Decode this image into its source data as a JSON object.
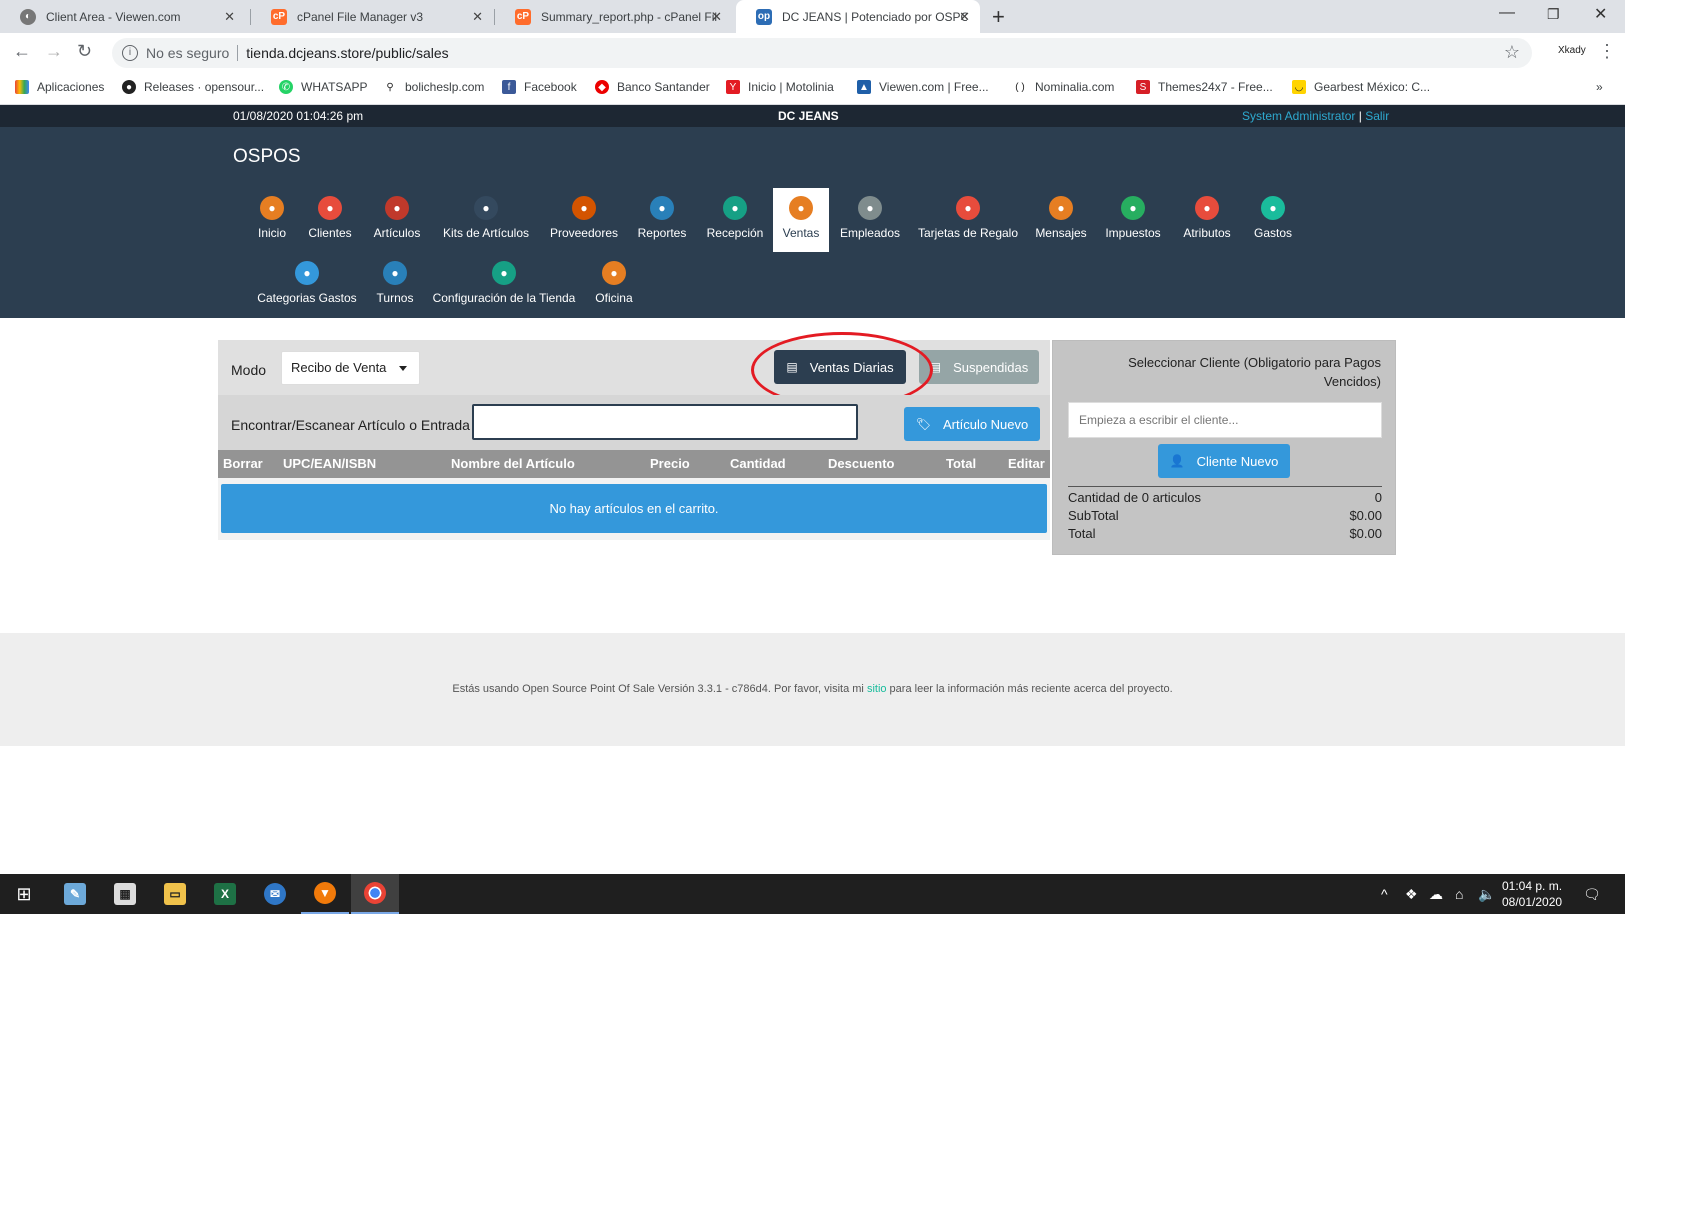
{
  "browser": {
    "tabs": [
      {
        "title": "Client Area - Viewen.com",
        "active": false
      },
      {
        "title": "cPanel File Manager v3",
        "active": false
      },
      {
        "title": "Summary_report.php - cPanel Fil",
        "active": false
      },
      {
        "title": "DC JEANS | Potenciado por OSPC",
        "active": true
      }
    ],
    "address": {
      "security_label": "No es seguro",
      "url": "tienda.dcjeans.store/public/sales"
    },
    "extension_label": "Xkady",
    "bookmarks": [
      "Aplicaciones",
      "Releases · opensour...",
      "WHATSAPP",
      "bolicheslp.com",
      "Facebook",
      "Banco Santander",
      "Inicio | Motolinia",
      "Viewen.com | Free...",
      "Nominalia.com",
      "Themes24x7 - Free...",
      "Gearbest México: C..."
    ],
    "more_bookmarks": "»"
  },
  "app": {
    "datetime": "01/08/2020 01:04:26 pm",
    "store_name": "DC JEANS",
    "user": "System Administrator",
    "user_sep": "|",
    "logout": "Salir",
    "brand": "OSPOS",
    "modules": [
      {
        "label": "Inicio",
        "color": "#e67e22"
      },
      {
        "label": "Clientes",
        "color": "#e74c3c"
      },
      {
        "label": "Artículos",
        "color": "#c0392b"
      },
      {
        "label": "Kits de Artículos",
        "color": "#34495e"
      },
      {
        "label": "Proveedores",
        "color": "#d35400"
      },
      {
        "label": "Reportes",
        "color": "#2980b9"
      },
      {
        "label": "Recepción",
        "color": "#16a085"
      },
      {
        "label": "Ventas",
        "color": "#e67e22",
        "active": true
      },
      {
        "label": "Empleados",
        "color": "#7f8c8d"
      },
      {
        "label": "Tarjetas de Regalo",
        "color": "#e74c3c"
      },
      {
        "label": "Mensajes",
        "color": "#e67e22"
      },
      {
        "label": "Impuestos",
        "color": "#27ae60"
      },
      {
        "label": "Atributos",
        "color": "#e74c3c"
      },
      {
        "label": "Gastos",
        "color": "#1abc9c"
      },
      {
        "label": "Categorias Gastos",
        "color": "#3498db"
      },
      {
        "label": "Turnos",
        "color": "#2980b9"
      },
      {
        "label": "Configuración de la Tienda",
        "color": "#16a085"
      },
      {
        "label": "Oficina",
        "color": "#e67e22"
      }
    ],
    "register": {
      "mode_label": "Modo",
      "mode_value": "Recibo de Venta",
      "daily_sales_button": "Ventas Diarias",
      "suspended_button": "Suspendidas",
      "search_label": "Encontrar/Escanear Artículo o Entrada",
      "search_value": "",
      "new_item_button": "Artículo Nuevo",
      "columns": [
        "Borrar",
        "UPC/EAN/ISBN",
        "Nombre del Artículo",
        "Precio",
        "Cantidad",
        "Descuento",
        "Total",
        "Editar"
      ],
      "empty_message": "No hay artículos en el carrito."
    },
    "customer": {
      "title": "Seleccionar Cliente (Obligatorio para Pagos Vencidos)",
      "input_placeholder": "Empieza a escribir el cliente...",
      "new_customer_button": "Cliente Nuevo",
      "totals": [
        {
          "label": "Cantidad de 0 articulos",
          "value": "0"
        },
        {
          "label": "SubTotal",
          "value": "$0.00"
        },
        {
          "label": "Total",
          "value": "$0.00"
        }
      ]
    },
    "footer": {
      "text_before": "Estás usando Open Source Point Of Sale Versión 3.3.1 - c786d4.",
      "text_mid": " Por favor, visita mi ",
      "link": "sitio",
      "text_after": " para leer la información más reciente acerca del proyecto."
    }
  },
  "taskbar": {
    "apps": [
      "windows-start",
      "paint",
      "calculator",
      "file-explorer",
      "excel",
      "outlook",
      "brave",
      "chrome"
    ],
    "time": "01:04 p. m.",
    "date": "08/01/2020"
  },
  "colors": {
    "navbar": "#2c3e50",
    "topstrip": "#1d2733",
    "primary": "#3498db",
    "annotation_ellipse": "#e31b23"
  }
}
